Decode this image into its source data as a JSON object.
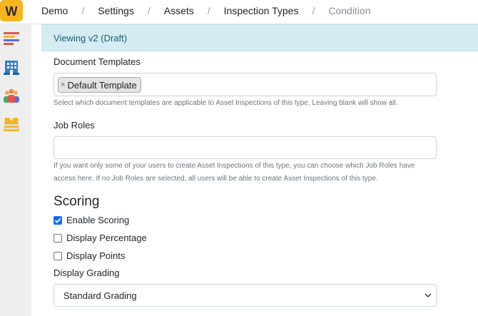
{
  "logo": {
    "letter": "W"
  },
  "breadcrumb": {
    "items": [
      "Demo",
      "Settings",
      "Assets",
      "Inspection Types"
    ],
    "current": "Condition",
    "separator": "/"
  },
  "sidebar": {
    "icons": [
      "list-icon",
      "building-icon",
      "users-icon",
      "safety-vest-icon"
    ]
  },
  "banner": {
    "text": "Viewing v2 (Draft)"
  },
  "document_templates": {
    "label": "Document Templates",
    "selected": [
      "Default Template"
    ],
    "remove_glyph": "×",
    "help": "Select which document templates are applicable to Asset Inspections of this type. Leaving blank will show all."
  },
  "job_roles": {
    "label": "Job Roles",
    "value": "",
    "help": "If you want only some of your users to create Asset Inspections of this type, you can choose which Job Roles have access here. If no Job Roles are selected, all users will be able to create Asset Inspections of this type."
  },
  "scoring": {
    "heading": "Scoring",
    "enable_scoring": {
      "label": "Enable Scoring",
      "checked": true
    },
    "display_percentage": {
      "label": "Display Percentage",
      "checked": false
    },
    "display_points": {
      "label": "Display Points",
      "checked": false
    },
    "display_grading": {
      "label": "Display Grading",
      "selected": "Standard Grading"
    }
  },
  "colors": {
    "banner_bg": "#d4ecf2",
    "banner_text": "#1c5f73",
    "checkbox": "#0d6efd",
    "logo_bg": "#f6b51e"
  }
}
